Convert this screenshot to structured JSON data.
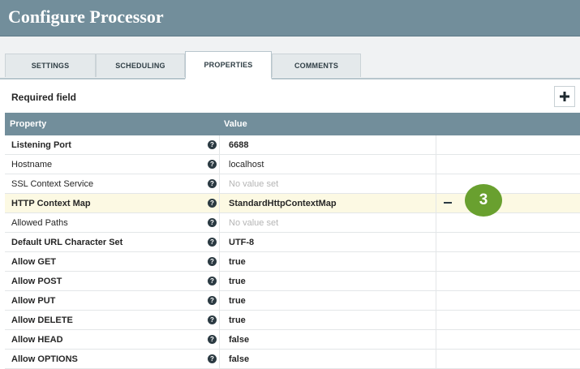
{
  "window": {
    "title": "Configure Processor"
  },
  "tabs": [
    {
      "label": "SETTINGS",
      "active": false
    },
    {
      "label": "SCHEDULING",
      "active": false
    },
    {
      "label": "PROPERTIES",
      "active": true
    },
    {
      "label": "COMMENTS",
      "active": false
    }
  ],
  "required_label": "Required field",
  "add_button": {
    "icon": "plus-icon",
    "label": "+"
  },
  "table": {
    "columns": [
      "Property",
      "Value"
    ],
    "rows": [
      {
        "name": "Listening Port",
        "value": "6688",
        "required": true
      },
      {
        "name": "Hostname",
        "value": "localhost",
        "required": false
      },
      {
        "name": "SSL Context Service",
        "value": "No value set",
        "required": false,
        "empty": true
      },
      {
        "name": "HTTP Context Map",
        "value": "StandardHttpContextMap",
        "required": true,
        "highlight": true
      },
      {
        "name": "Allowed Paths",
        "value": "No value set",
        "required": false,
        "empty": true
      },
      {
        "name": "Default URL Character Set",
        "value": "UTF-8",
        "required": true
      },
      {
        "name": "Allow GET",
        "value": "true",
        "required": true
      },
      {
        "name": "Allow POST",
        "value": "true",
        "required": true
      },
      {
        "name": "Allow PUT",
        "value": "true",
        "required": true
      },
      {
        "name": "Allow DELETE",
        "value": "true",
        "required": true
      },
      {
        "name": "Allow HEAD",
        "value": "false",
        "required": true
      },
      {
        "name": "Allow OPTIONS",
        "value": "false",
        "required": true
      }
    ],
    "help_glyph": "?"
  },
  "callout": {
    "label": "3"
  },
  "colors": {
    "header": "#728e9b",
    "callout": "#69a02f",
    "highlight_row": "#fcf9e3"
  }
}
